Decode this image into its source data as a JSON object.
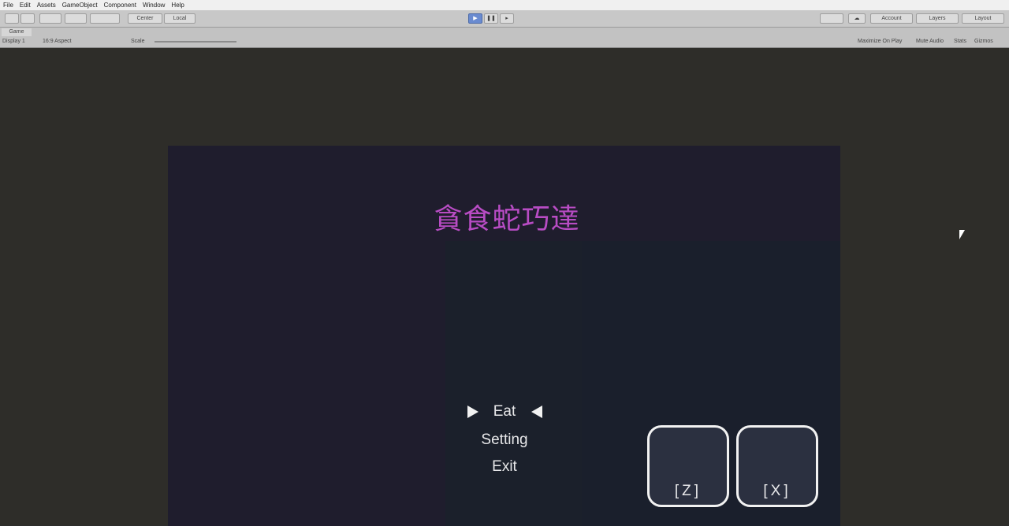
{
  "menubar": {
    "items": [
      "File",
      "Edit",
      "Assets",
      "GameObject",
      "Component",
      "Window",
      "Help"
    ]
  },
  "toolbar": {
    "pivot_label": "Center",
    "space_label": "Local",
    "account_label": "Account",
    "layers_label": "Layers",
    "layout_label": "Layout"
  },
  "gamebar": {
    "tab_label": "Game",
    "display_label": "Display 1",
    "aspect_label": "16:9 Aspect",
    "scale_label": "Scale",
    "maximize_label": "Maximize On Play",
    "mute_label": "Mute Audio",
    "stats_label": "Stats",
    "gizmos_label": "Gizmos"
  },
  "game": {
    "title": "貪食蛇巧達",
    "menu": {
      "items": [
        "Eat",
        "Setting",
        "Exit"
      ],
      "selected_index": 0
    },
    "keys": [
      {
        "label": "[Z]"
      },
      {
        "label": "[X]"
      }
    ]
  },
  "colors": {
    "title": "#b84cc4",
    "background": "#1f1d2d",
    "panel": "#1a1f2c",
    "key_border": "#f2f2f2"
  }
}
